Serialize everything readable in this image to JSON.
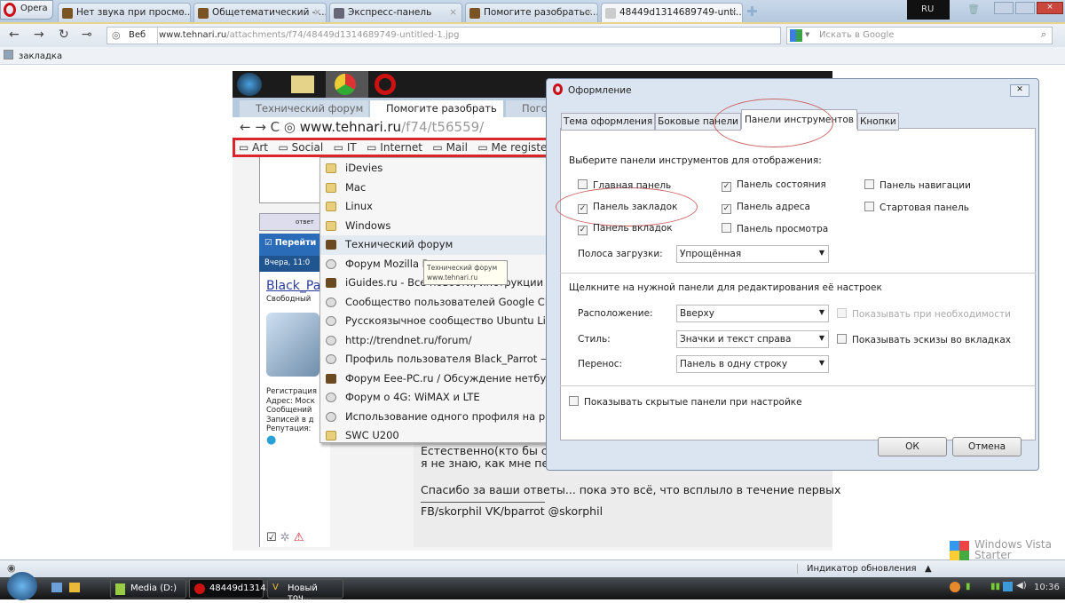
{
  "browser": {
    "menu_label": "Opera",
    "tabs": [
      {
        "label": "Нет звука при просмо..."
      },
      {
        "label": "Общетематический - ..."
      },
      {
        "label": "Экспресс-панель"
      },
      {
        "label": "Помогите разобратьс..."
      },
      {
        "label": "48449d1314689749-unti..."
      }
    ],
    "lang": "RU",
    "address_prefix": "Веб",
    "url_domain": "www.tehnari.ru",
    "url_path": "/attachments/f74/48449d1314689749-untitled-1.jpg",
    "search_placeholder": "Искать в Google",
    "bookmark": "закладка"
  },
  "screenshot": {
    "tabs": [
      "Технический форум",
      "Помогите разобрать",
      "Погод"
    ],
    "url_domain": "www.tehnari.ru",
    "url_path": "/f74/t56559/",
    "bookmarks": [
      "Art",
      "Social",
      "IT",
      "Internet",
      "Mail",
      "Me registered"
    ],
    "menu": [
      {
        "label": "iDevies",
        "icon": "folder"
      },
      {
        "label": "Mac",
        "icon": "folder"
      },
      {
        "label": "Linux",
        "icon": "folder"
      },
      {
        "label": "Windows",
        "icon": "folder"
      },
      {
        "label": "Технический форум",
        "icon": "site"
      },
      {
        "label": "Форум Mozilla Россия",
        "icon": "globe"
      },
      {
        "label": "iGuides.ru - Все новости, инструкции и н",
        "icon": "site"
      },
      {
        "label": "Сообщество пользователей Google Chrome",
        "icon": "globe"
      },
      {
        "label": "Русскоязычное сообщество Ubuntu Linux",
        "icon": "globe"
      },
      {
        "label": "http://trendnet.ru/forum/",
        "icon": "globe"
      },
      {
        "label": "Профиль пользователя Black_Parrot — Pu",
        "icon": "globe"
      },
      {
        "label": "Форум Eee-PC.ru / Обсуждение нетбуков",
        "icon": "site"
      },
      {
        "label": "Форум о 4G: WiMAX и LTE",
        "icon": "globe"
      },
      {
        "label": "Использование одного профиля на разн",
        "icon": "globe"
      },
      {
        "label": "SWC U200",
        "icon": "folder"
      }
    ],
    "tooltip_title": "Технический форум",
    "tooltip_url": "www.tehnari.ru",
    "goto": "Перейти",
    "date": "Вчера, 11:0",
    "reply": "ответ",
    "username": "Black_Pa",
    "user_status": "Свободный",
    "user_info": [
      "Регистрация",
      "Адрес: Моск",
      "Сообщений",
      "Записей в д",
      "Репутация:"
    ],
    "post_lines": [
      "Естественно(кто бы со",
      "я не знаю, как мне пе",
      "Спасибо за ваши ответы... пока это всё, что всплыло в течение первых",
      "FB/skorphil VK/bparrot @skorphil"
    ]
  },
  "dialog": {
    "title": "Оформление",
    "tabs": [
      "Тема оформления",
      "Боковые панели",
      "Панели инструментов",
      "Кнопки"
    ],
    "section1": "Выберите панели инструментов для отображения:",
    "checks": [
      {
        "label": "Главная панель",
        "checked": false
      },
      {
        "label": "Панель закладок",
        "checked": true
      },
      {
        "label": "Панель вкладок",
        "checked": true
      },
      {
        "label": "Панель состояния",
        "checked": true
      },
      {
        "label": "Панель адреса",
        "checked": true
      },
      {
        "label": "Панель просмотра",
        "checked": false
      },
      {
        "label": "Панель навигации",
        "checked": false
      },
      {
        "label": "Стартовая панель",
        "checked": false
      }
    ],
    "progress_label": "Полоса загрузки:",
    "progress_value": "Упрощённая",
    "section2": "Щелкните на нужной панели для редактирования её настроек",
    "placement_label": "Расположение:",
    "placement_value": "Вверху",
    "style_label": "Стиль:",
    "style_value": "Значки и текст справа",
    "wrap_label": "Перенос:",
    "wrap_value": "Панель в одну строку",
    "show_when_needed": "Показывать при необходимости",
    "show_thumbs": "Показывать эскизы во вкладках",
    "show_hidden": "Показывать скрытые панели при настройке",
    "ok": "ОК",
    "cancel": "Отмена"
  },
  "status": {
    "update_indicator": "Индикатор обновления",
    "watermark": "Windows Vista Starter"
  },
  "taskbar": {
    "items": [
      "Media (D:)",
      "48449d1314...",
      "Новый точ..."
    ],
    "clock": "10:36"
  },
  "colors": {
    "highlight_red": "#d8262b",
    "opera_red": "#cc0f16"
  }
}
